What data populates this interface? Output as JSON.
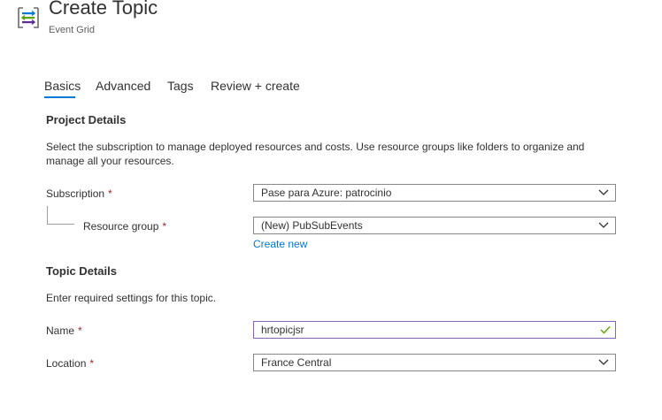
{
  "header": {
    "title": "Create Topic",
    "subtitle": "Event Grid",
    "icon": "event-grid-icon"
  },
  "tabs": [
    {
      "label": "Basics",
      "active": true
    },
    {
      "label": "Advanced",
      "active": false
    },
    {
      "label": "Tags",
      "active": false
    },
    {
      "label": "Review + create",
      "active": false
    }
  ],
  "project": {
    "heading": "Project Details",
    "description": "Select the subscription to manage deployed resources and costs. Use resource groups like folders to organize and manage all your resources.",
    "subscription_label": "Subscription",
    "subscription_value": "Pase para Azure: patrocinio",
    "resource_group_label": "Resource group",
    "resource_group_value": "(New) PubSubEvents",
    "create_new_link": "Create new"
  },
  "topic": {
    "heading": "Topic Details",
    "description": "Enter required settings for this topic.",
    "name_label": "Name",
    "name_value": "hrtopicjsr",
    "location_label": "Location",
    "location_value": "France Central"
  },
  "required_marker": "*",
  "colors": {
    "accent": "#0078d4",
    "required": "#a4262c",
    "valid_check": "#57a300",
    "valid_border": "#8764b8"
  }
}
